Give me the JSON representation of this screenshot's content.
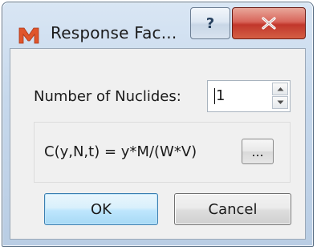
{
  "window": {
    "title": "Response Fac...",
    "help_label": "?",
    "close_icon": "close-icon"
  },
  "form": {
    "nuclides_label": "Number of Nuclides:",
    "nuclides_value": "1",
    "formula": "C(y,N,t) = y*M/(W*V)",
    "formula_button_label": "..."
  },
  "buttons": {
    "ok_label": "OK",
    "cancel_label": "Cancel"
  },
  "colors": {
    "close_button": "#c1372b",
    "ok_button": "#bee6fd",
    "app_icon": "#e0552b"
  }
}
